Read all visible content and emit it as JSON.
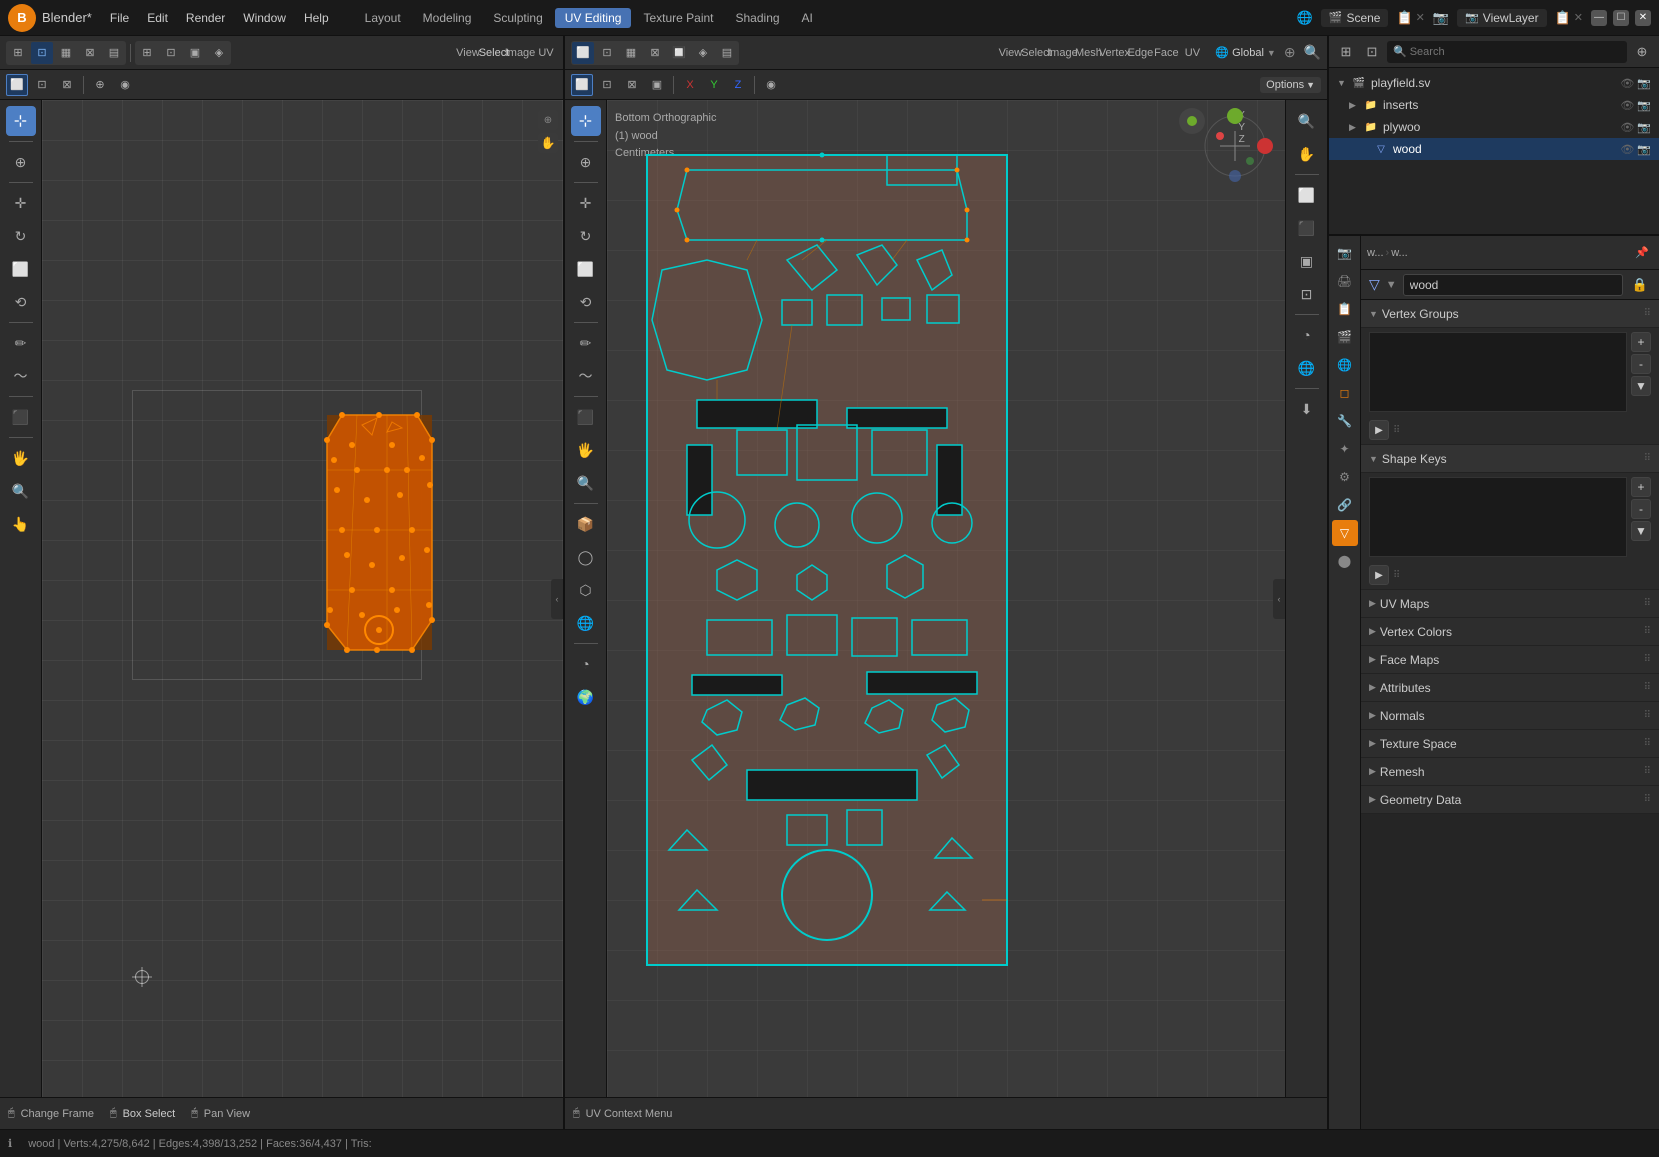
{
  "app": {
    "title": "Blender*",
    "logo": "B"
  },
  "menubar": {
    "items": [
      "File",
      "Edit",
      "Render",
      "Window",
      "Help"
    ]
  },
  "workspaces": {
    "tabs": [
      "Layout",
      "Modeling",
      "Sculpting",
      "UV Editing",
      "Texture Paint",
      "Shading",
      "AI"
    ],
    "active": "UV Editing"
  },
  "scene": {
    "label": "Scene"
  },
  "viewlayer": {
    "label": "ViewLayer"
  },
  "window": {
    "minimize": "—",
    "maximize": "☐",
    "close": "✕"
  },
  "left_viewport": {
    "menus": [
      "View",
      "Select",
      "Image",
      "UV"
    ],
    "view_label": "Select",
    "bottom": {
      "left_label": "Change Frame",
      "middle_label": "Box Select",
      "right_label": "Pan View"
    }
  },
  "uv_editor": {
    "menus": [
      "View",
      "Select",
      "Image",
      "Mesh",
      "Vertex",
      "Edge",
      "Face",
      "UV"
    ],
    "viewport_label": "Bottom Orthographic",
    "object_label": "(1) wood",
    "unit_label": "Centimeters",
    "nav_axes": [
      "X",
      "Y",
      "Z"
    ],
    "options_label": "Options",
    "bottom_label": "UV Context Menu",
    "status": "wood | Verts:4,275/8,642 | Edges:4,398/13,252 | Faces:36/4,437 | Tris:"
  },
  "outliner": {
    "items": [
      {
        "label": "playfield.sv",
        "type": "scene",
        "expanded": true,
        "icons": [
          "eye",
          "camera"
        ]
      },
      {
        "label": "inserts",
        "type": "collection",
        "indent": 1,
        "icons": [
          "eye",
          "camera"
        ]
      },
      {
        "label": "plywoo",
        "type": "collection",
        "indent": 1,
        "icons": [
          "eye",
          "camera"
        ]
      },
      {
        "label": "wood",
        "type": "mesh",
        "indent": 2,
        "active": true,
        "icons": [
          "eye",
          "camera"
        ]
      }
    ]
  },
  "properties": {
    "sidebar_tabs": [
      "scene",
      "render",
      "output",
      "view",
      "object",
      "modifier",
      "particles",
      "physics",
      "constraint",
      "data",
      "material",
      "world"
    ],
    "active_tab": "data",
    "breadcrumb": [
      "w...",
      ">",
      "w..."
    ],
    "object_name": "wood",
    "sections": [
      {
        "id": "vertex_groups",
        "label": "Vertex Groups",
        "expanded": true
      },
      {
        "id": "shape_keys",
        "label": "Shape Keys",
        "expanded": true
      },
      {
        "id": "uv_maps",
        "label": "UV Maps",
        "collapsed": true
      },
      {
        "id": "vertex_colors",
        "label": "Vertex Colors",
        "collapsed": true
      },
      {
        "id": "face_maps",
        "label": "Face Maps",
        "collapsed": true
      },
      {
        "id": "attributes",
        "label": "Attributes",
        "collapsed": true
      },
      {
        "id": "normals",
        "label": "Normals",
        "collapsed": true
      },
      {
        "id": "texture_space",
        "label": "Texture Space",
        "collapsed": true
      },
      {
        "id": "remesh",
        "label": "Remesh",
        "collapsed": true
      },
      {
        "id": "geometry_data",
        "label": "Geometry Data",
        "collapsed": true
      }
    ]
  },
  "tools": {
    "left_tools": [
      "↖",
      "↔",
      "↺",
      "⬜",
      "🔄",
      "✏",
      "〰",
      "⬛",
      "🖐",
      "✋"
    ],
    "uv_tools": [
      "↖",
      "↔",
      "↺",
      "⬜",
      "🔄",
      "✏",
      "〰",
      "⬛",
      "📦",
      "🔘",
      "⬡",
      "🌐",
      "⬤"
    ]
  }
}
